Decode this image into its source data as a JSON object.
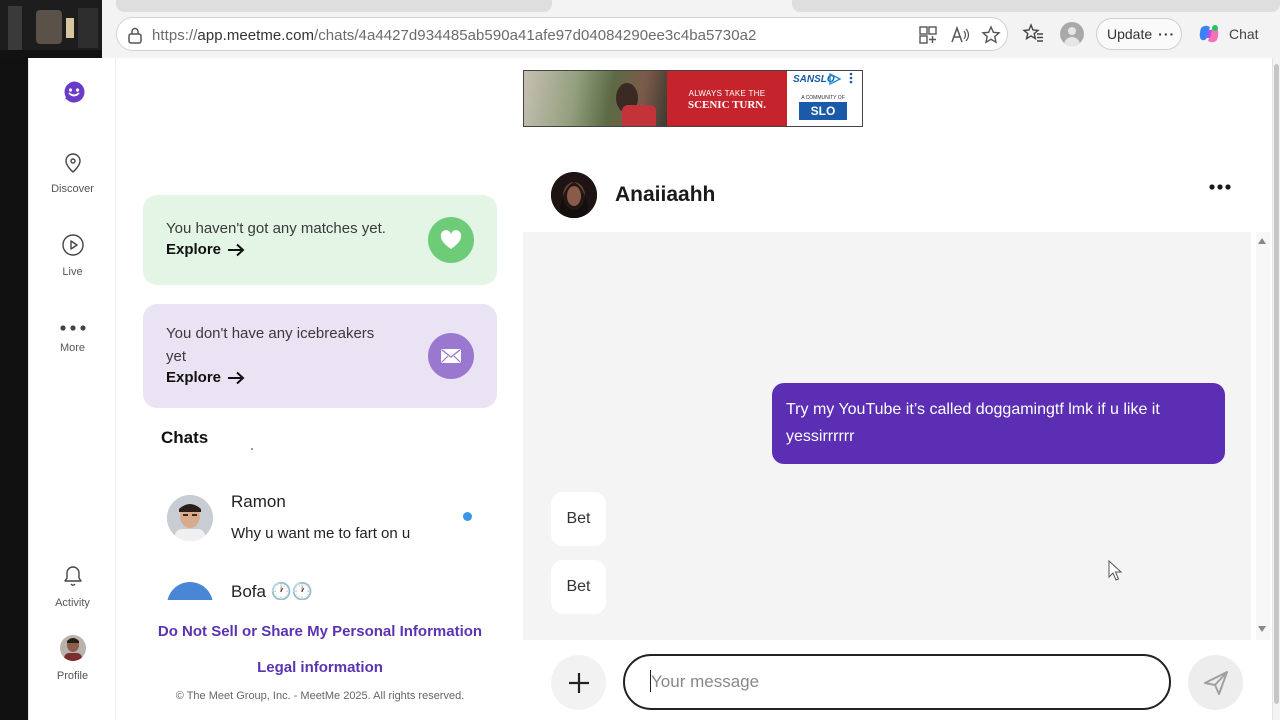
{
  "browser": {
    "url_prefix": "https://",
    "url_domain": "app.meetme.com",
    "url_path": "/chats/4a4427d934485ab590a41afe97d04084290ee3c4ba5730a2",
    "update_label": "Update",
    "update_more": "···",
    "chat_label": "Chat"
  },
  "nav": {
    "discover": "Discover",
    "live": "Live",
    "more": "More",
    "activity": "Activity",
    "profile": "Profile"
  },
  "ad": {
    "tagline_top": "ALWAYS TAKE THE",
    "tagline_main": "SCENIC TURN.",
    "brand_top": "SANSLO",
    "community": "A COMMUNITY OF",
    "brand_bottom": "SLO CAL"
  },
  "cards": {
    "matches": {
      "text": "You haven't got any matches yet.",
      "cta": "Explore"
    },
    "icebreakers": {
      "text_line1": "You don't have any icebreakers",
      "text_line2": "yet",
      "cta": "Explore"
    }
  },
  "chats": {
    "heading": "Chats",
    "items": [
      {
        "name": "Ramon",
        "preview": "Why u want me to fart on u",
        "unread": true
      },
      {
        "name": "Bofa",
        "emoji": "🕐🕐"
      }
    ]
  },
  "footer": {
    "do_not_sell": "Do Not Sell or Share My Personal Information",
    "legal": "Legal information",
    "copyright": "© The Meet Group, Inc. - MeetMe 2025. All rights reserved."
  },
  "conversation": {
    "name": "Anaiiaahh",
    "messages": [
      {
        "direction": "out",
        "text": "Try my YouTube it’s called doggamingtf lmk if u like it yessirrrrrr"
      },
      {
        "direction": "in",
        "text": "Bet"
      },
      {
        "direction": "in",
        "text": "Bet"
      }
    ],
    "input_placeholder": "Your message"
  },
  "colors": {
    "brand_purple": "#5b2eb3",
    "matches_bg": "#e3f5e5",
    "icebreakers_bg": "#e9e3f4",
    "unread_dot": "#3a97e6"
  }
}
